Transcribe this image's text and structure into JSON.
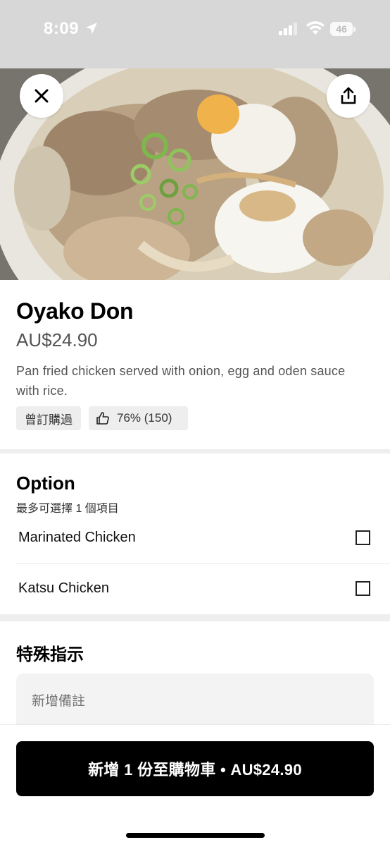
{
  "status_bar": {
    "time": "8:09",
    "battery": "46"
  },
  "header": {
    "close_icon": "close-icon",
    "share_icon": "share-icon"
  },
  "item": {
    "title": "Oyako Don",
    "price": "AU$24.90",
    "description": "Pan fried chicken served with onion, egg and oden sauce with rice.",
    "ordered_badge": "曾訂購過",
    "rating_badge": "76% (150)"
  },
  "options": {
    "title": "Option",
    "subtitle": "最多可選擇 1 個項目",
    "items": [
      {
        "label": "Marinated Chicken",
        "checked": false
      },
      {
        "label": "Katsu Chicken",
        "checked": false
      }
    ]
  },
  "special": {
    "title": "特殊指示",
    "placeholder": "新增備註"
  },
  "cart": {
    "button_label": "新增 1 份至購物車 • AU$24.90"
  },
  "colors": {
    "accent": "#000000",
    "chip_bg": "#eeeeee",
    "muted_text": "#545454"
  }
}
